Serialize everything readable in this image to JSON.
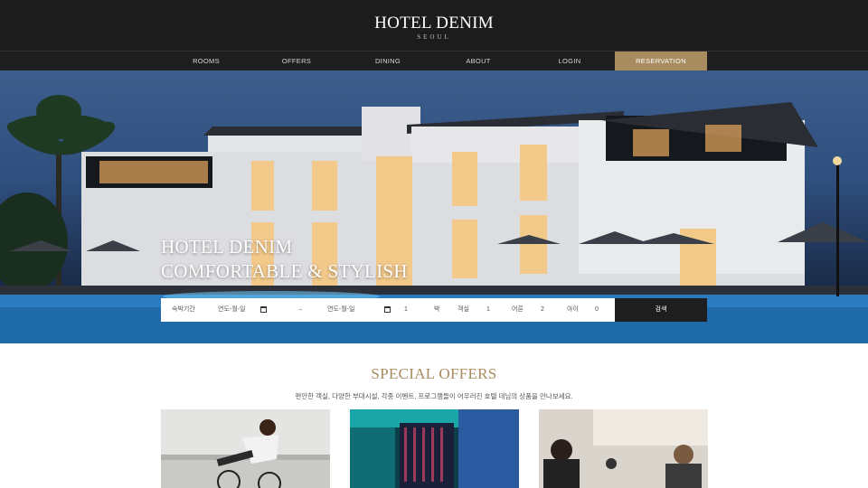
{
  "header": {
    "logo": "HOTEL DENIM",
    "logo_sub": "SEOUL"
  },
  "nav": {
    "items": [
      {
        "label": "ROOMS"
      },
      {
        "label": "OFFERS"
      },
      {
        "label": "DINING"
      },
      {
        "label": "ABOUT"
      },
      {
        "label": "LOGIN"
      },
      {
        "label": "RESERVATION"
      }
    ]
  },
  "hero": {
    "title_line1": "HOTEL DENIM",
    "title_line2": "COMFORTABLE & STYLISH"
  },
  "booking": {
    "period_label": "숙박기간",
    "checkin_placeholder": "연도-월-일",
    "arrow": "→",
    "checkout_placeholder": "연도-월-일",
    "nights_value": "1",
    "nights_unit": "박",
    "rooms_label": "객실",
    "rooms_value": "1",
    "adults_label": "어른",
    "adults_value": "2",
    "children_label": "아이",
    "children_value": "0",
    "search_label": "검색"
  },
  "offers": {
    "title": "SPECIAL OFFERS",
    "subtitle": "편안한 객실, 다양한 부대시설, 각종 이벤트, 프로그램들이 어우러진 호텔 데님의 상품을 만나보세요."
  },
  "colors": {
    "accent": "#a88b5e",
    "dark": "#1c1c1c"
  }
}
